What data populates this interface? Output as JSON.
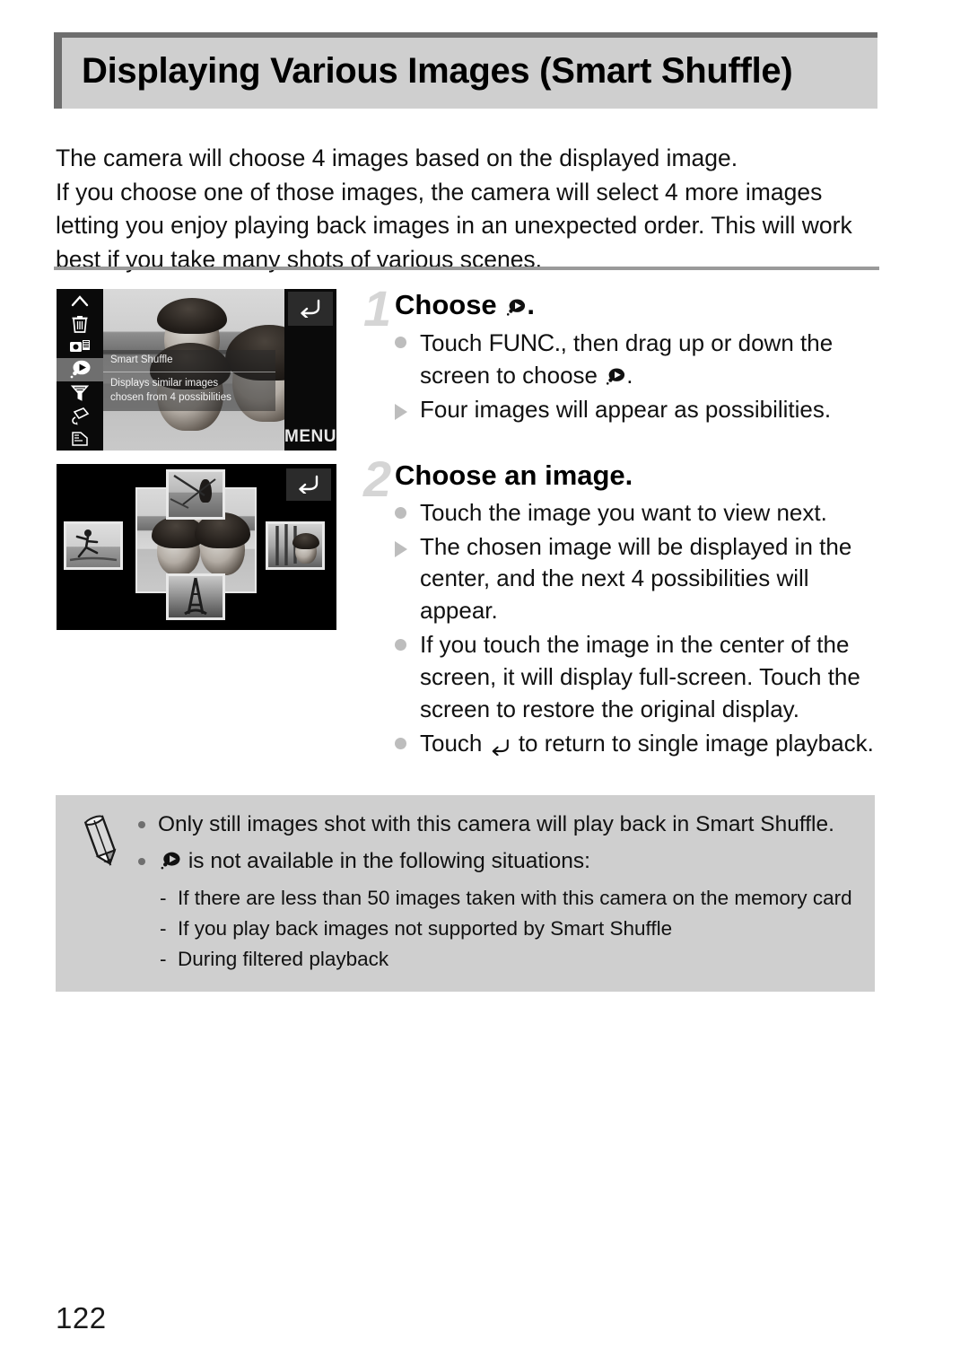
{
  "heading": {
    "title": "Displaying Various Images (Smart Shuffle)"
  },
  "intro": {
    "line1": "The camera will choose 4 images based on the displayed image.",
    "line2": "If you choose one of those images, the camera will select 4 more images letting you enjoy playing back images in an unexpected order. This will work best if you take many shots of various scenes."
  },
  "figure1": {
    "menu_items": [
      "scroll-up-icon",
      "trash-icon",
      "slideshow-icon",
      "smart-shuffle-icon",
      "filter-playback-icon",
      "rotate-icon",
      "protect-icon"
    ],
    "overlay_title": "Smart Shuffle",
    "overlay_desc_line1": "Displays similar images",
    "overlay_desc_line2": "chosen from 4 possibilities",
    "menu_button_label": "MENU",
    "back_button": "return-arrow-icon"
  },
  "figure2": {
    "back_button": "return-arrow-icon",
    "center_image": "beach-portrait-photo",
    "thumbnails": [
      "windsurfer-photo",
      "beach-runner-photo",
      "surfboards-portrait-photo",
      "eiffel-tower-photo"
    ]
  },
  "steps": [
    {
      "number": "1",
      "title_prefix": "Choose",
      "title_icon": "smart-shuffle-icon",
      "title_suffix": ".",
      "bullets": [
        {
          "marker": "dot",
          "text_before": "Touch ",
          "inline_word": "FUNC.",
          "text_middle": ", then drag up or down the screen to choose ",
          "inline_icon": "smart-shuffle-icon",
          "text_after": "."
        },
        {
          "marker": "triangle",
          "text": "Four images will appear as possibilities."
        }
      ]
    },
    {
      "number": "2",
      "title": "Choose an image.",
      "bullets": [
        {
          "marker": "dot",
          "text": "Touch the image you want to view next."
        },
        {
          "marker": "triangle",
          "text": "The chosen image will be displayed in the center, and the next 4 possibilities will appear."
        },
        {
          "marker": "dot",
          "text": "If you touch the image in the center of the screen, it will display full-screen. Touch the screen to restore the original display."
        },
        {
          "marker": "dot",
          "text_before": "Touch ",
          "inline_icon": "return-arrow-icon",
          "text_after": " to return to single image playback."
        }
      ]
    }
  ],
  "note": {
    "icon": "pencil-icon",
    "bullet1": "Only still images shot with this camera will play back in Smart Shuffle.",
    "bullet2_icon": "smart-shuffle-icon",
    "bullet2_text": "is not available in the following situations:",
    "sub_items": [
      "If there are less than 50 images taken with this camera on the memory card",
      "If you play back images not supported by Smart Shuffle",
      "During filtered playback"
    ],
    "dash": "-"
  },
  "page": {
    "number": "122"
  },
  "colors": {
    "heading_bg": "#cfcfcf",
    "heading_accent": "#6e6e6e",
    "note_bg": "#cfcfcf",
    "marker_gray": "#bdbdbd",
    "step_number_gray": "#d5d5d5"
  }
}
